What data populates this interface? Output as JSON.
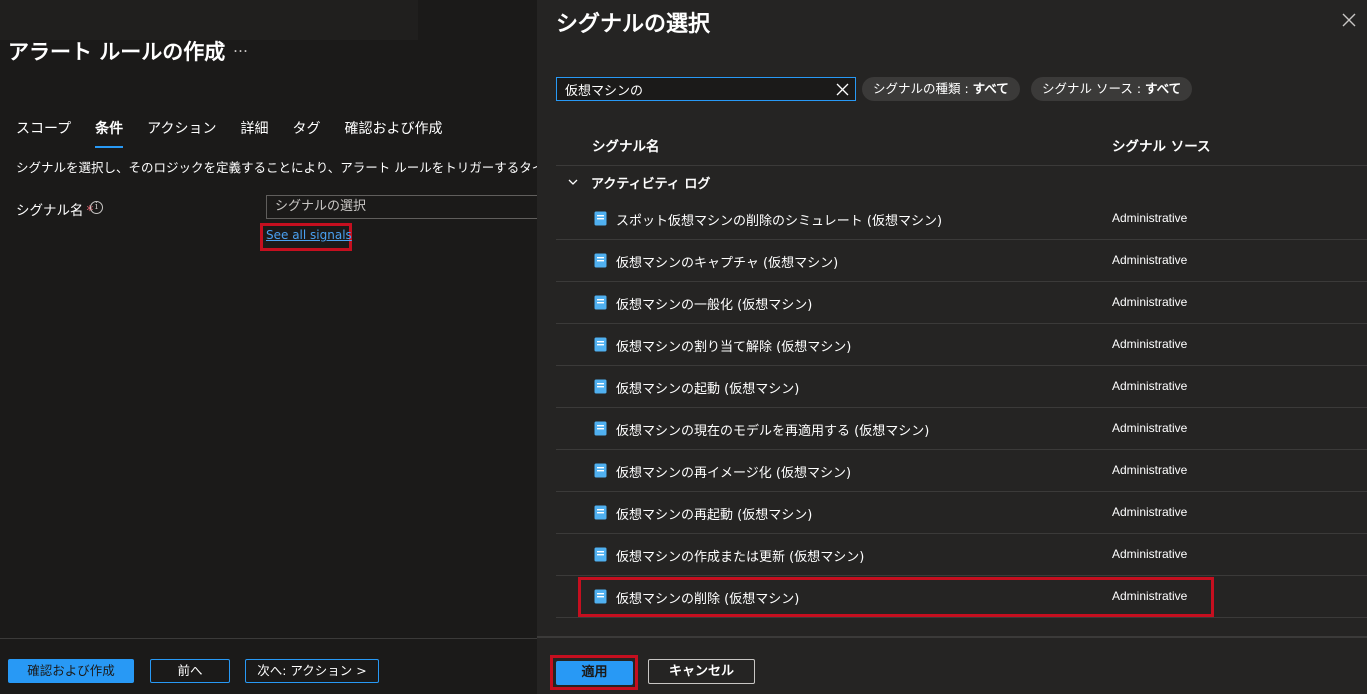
{
  "page": {
    "title": "アラート ルールの作成",
    "more": "…",
    "tabs": [
      {
        "label": "スコープ"
      },
      {
        "label": "条件"
      },
      {
        "label": "アクション"
      },
      {
        "label": "詳細"
      },
      {
        "label": "タグ"
      },
      {
        "label": "確認および作成"
      }
    ],
    "description": "シグナルを選択し、そのロジックを定義することにより、アラート ルールをトリガーするタイミングを構成します。",
    "signal_label": "シグナル名",
    "required_mark": "*",
    "info": "i",
    "signal_placeholder": "シグナルの選択",
    "see_all": "See all signals",
    "footer": {
      "review": "確認および作成",
      "previous": "前へ",
      "next": "次へ: アクション >"
    }
  },
  "panel": {
    "title": "シグナルの選択",
    "search_value": "仮想マシンの",
    "filter_type_label": "シグナルの種類 : ",
    "filter_type_value": "すべて",
    "filter_source_label": "シグナル ソース : ",
    "filter_source_value": "すべて",
    "col_name": "シグナル名",
    "col_source": "シグナル ソース",
    "group": "アクティビティ ログ",
    "rows": [
      {
        "name": "スポット仮想マシンの削除のシミュレート (仮想マシン)",
        "source": "Administrative"
      },
      {
        "name": "仮想マシンのキャプチャ (仮想マシン)",
        "source": "Administrative"
      },
      {
        "name": "仮想マシンの一般化 (仮想マシン)",
        "source": "Administrative"
      },
      {
        "name": "仮想マシンの割り当て解除 (仮想マシン)",
        "source": "Administrative"
      },
      {
        "name": "仮想マシンの起動 (仮想マシン)",
        "source": "Administrative"
      },
      {
        "name": "仮想マシンの現在のモデルを再適用する (仮想マシン)",
        "source": "Administrative"
      },
      {
        "name": "仮想マシンの再イメージ化 (仮想マシン)",
        "source": "Administrative"
      },
      {
        "name": "仮想マシンの再起動 (仮想マシン)",
        "source": "Administrative"
      },
      {
        "name": "仮想マシンの作成または更新 (仮想マシン)",
        "source": "Administrative"
      },
      {
        "name": "仮想マシンの削除 (仮想マシン)",
        "source": "Administrative"
      }
    ],
    "apply": "適用",
    "cancel": "キャンセル"
  },
  "colors": {
    "accent": "#2899f5",
    "highlight": "#c50f1f",
    "background": "#1b1a19",
    "panel": "#252423"
  }
}
